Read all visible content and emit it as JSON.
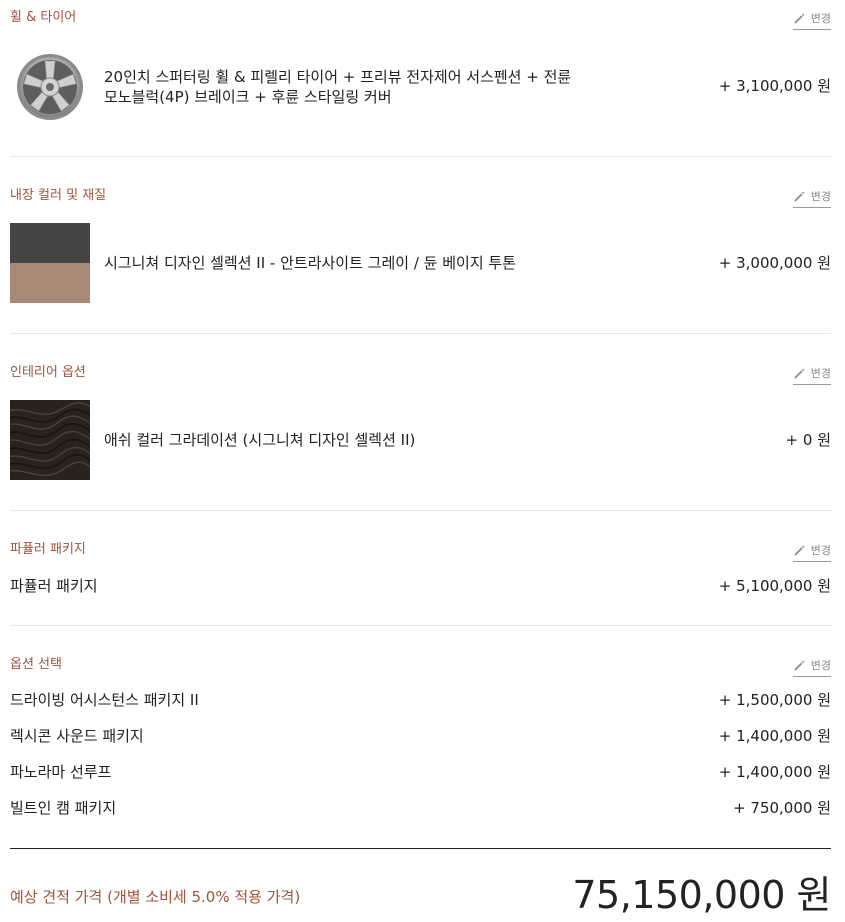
{
  "edit_label": "변경",
  "sections": {
    "wheels": {
      "title": "휠 & 타이어",
      "item_name_line1": "20인치 스퍼터링 휠 & 피렐리 타이어 + 프리뷰 전자제어 서스펜션 + 전륜",
      "item_name_line2": "모노블럭(4P) 브레이크 + 후륜 스타일링 커버",
      "price": "+ 3,100,000 원",
      "icon": "wheel-icon"
    },
    "interior_color": {
      "title": "내장 컬러 및 재질",
      "item_name": "시그니쳐 디자인 셀렉션 II - 안트라사이트 그레이 / 듄 베이지 투톤",
      "price": "+ 3,000,000 원",
      "colors": {
        "top": "#454545",
        "bottom": "#a88a78"
      }
    },
    "interior_option": {
      "title": "인테리어 옵션",
      "item_name": "애쉬 컬러 그라데이션 (시그니쳐 디자인 셀렉션 II)",
      "price": "+ 0 원"
    },
    "parfler": {
      "title": "파퓰러 패키지",
      "item_name": "파퓰러 패키지",
      "price": "+ 5,100,000 원"
    },
    "options": {
      "title": "옵션 선택",
      "items": [
        {
          "name": "드라이빙 어시스턴스 패키지 II",
          "price": "+ 1,500,000 원"
        },
        {
          "name": "렉시콘 사운드 패키지",
          "price": "+ 1,400,000 원"
        },
        {
          "name": "파노라마 선루프",
          "price": "+ 1,400,000 원"
        },
        {
          "name": "빌트인 캠 패키지",
          "price": "+ 750,000 원"
        }
      ]
    }
  },
  "total": {
    "label": "예상 견적 가격 (개별 소비세 5.0% 적용 가격)",
    "price": "75,150,000 원"
  },
  "colors": {
    "accent": "#a0543b",
    "text": "#222222",
    "muted": "#8a8a8a"
  }
}
